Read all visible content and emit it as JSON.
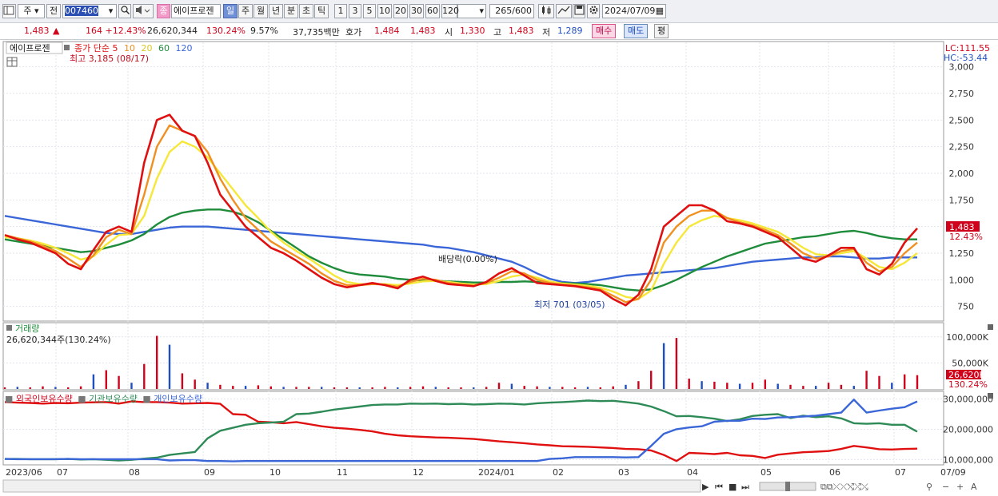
{
  "toolbar": {
    "period_type": "주",
    "prev_label": "전",
    "code": "007460",
    "indicator_label": "종",
    "stock_name": "에이프로젠",
    "timeframes": [
      "일",
      "주",
      "월",
      "년",
      "분",
      "초",
      "틱"
    ],
    "intervals": [
      "1",
      "3",
      "5",
      "10",
      "20",
      "30",
      "60",
      "120"
    ],
    "count": "265",
    "count_total": "/600",
    "date": "2024/07/09"
  },
  "quote": {
    "price": "1,483",
    "arrow": "▲",
    "change": "164 +12.43%",
    "volume": "26,620,344",
    "volume_ratio": "130.24%",
    "turnover": "9.57%",
    "amount": "37,735백만",
    "bid_label": "호가",
    "bid1": "1,484",
    "bid2": "1,483",
    "open_label": "시",
    "open": "1,330",
    "high_label": "고",
    "high": "1,483",
    "low_label": "저",
    "low": "1,289",
    "buy_label": "매수",
    "sell_label": "매도",
    "eq_label": "평"
  },
  "colors": {
    "ma5": "#e01010",
    "ma10": "#f09020",
    "ma20": "#f5e838",
    "ma60": "#1e8c3a",
    "ma120": "#3a66d8",
    "up": "#d0021b",
    "down": "#1f4fbf",
    "foreign": "#e01010",
    "institution": "#2e8b57",
    "individual": "#3a66d8"
  },
  "chart_data": [
    {
      "type": "line",
      "title": "에이프로젠",
      "legend": [
        "종가 단순 5",
        "10",
        "20",
        "60",
        "120"
      ],
      "y_ticks": [
        "3,000",
        "2,750",
        "2,500",
        "2,250",
        "2,000",
        "1,750",
        "1,500",
        "1,250",
        "1,000",
        "750"
      ],
      "ylim": [
        620,
        3230
      ],
      "x_tick_labels": [
        "2023/06",
        "07",
        "08",
        "09",
        "10",
        "11",
        "12",
        "2024/01",
        "02",
        "03",
        "04",
        "05",
        "06",
        "07",
        "07/09"
      ],
      "lc_label": "LC:111.55",
      "hc_label": "HC:-53.44",
      "last_price_label": "1,483",
      "last_change_label": "12.43%",
      "annotations": {
        "high": "최고 3,185 (08/17)",
        "low": "최저 701 (03/05)",
        "dividend": "배당락(0.00%)"
      },
      "series": [
        {
          "name": "종가 단순 5",
          "values": [
            1420,
            1380,
            1350,
            1300,
            1250,
            1150,
            1100,
            1280,
            1450,
            1500,
            1450,
            2100,
            2500,
            2550,
            2400,
            2350,
            2100,
            1800,
            1650,
            1500,
            1400,
            1300,
            1250,
            1180,
            1100,
            1020,
            960,
            930,
            950,
            970,
            950,
            920,
            1000,
            1030,
            990,
            960,
            950,
            940,
            980,
            1060,
            1110,
            1040,
            970,
            960,
            950,
            940,
            920,
            900,
            820,
            760,
            860,
            1100,
            1500,
            1600,
            1700,
            1700,
            1650,
            1550,
            1530,
            1500,
            1450,
            1400,
            1300,
            1200,
            1170,
            1230,
            1300,
            1300,
            1100,
            1050,
            1150,
            1350,
            1483
          ]
        },
        {
          "name": "10",
          "values": [
            1420,
            1390,
            1360,
            1320,
            1270,
            1200,
            1120,
            1230,
            1400,
            1470,
            1430,
            1800,
            2250,
            2450,
            2400,
            2350,
            2200,
            1950,
            1750,
            1580,
            1470,
            1360,
            1290,
            1220,
            1150,
            1060,
            990,
            950,
            950,
            960,
            955,
            935,
            980,
            1010,
            1000,
            970,
            955,
            945,
            970,
            1020,
            1080,
            1060,
            1000,
            970,
            955,
            945,
            930,
            910,
            850,
            790,
            820,
            1000,
            1350,
            1500,
            1600,
            1650,
            1650,
            1580,
            1540,
            1510,
            1470,
            1420,
            1340,
            1250,
            1200,
            1220,
            1270,
            1290,
            1160,
            1080,
            1120,
            1250,
            1350
          ]
        },
        {
          "name": "20",
          "values": [
            1400,
            1390,
            1370,
            1340,
            1300,
            1250,
            1190,
            1220,
            1330,
            1420,
            1430,
            1600,
            1950,
            2200,
            2300,
            2250,
            2150,
            2000,
            1850,
            1700,
            1580,
            1450,
            1350,
            1270,
            1200,
            1120,
            1040,
            980,
            960,
            960,
            960,
            950,
            965,
            985,
            990,
            980,
            965,
            955,
            960,
            990,
            1030,
            1050,
            1020,
            985,
            965,
            955,
            945,
            925,
            890,
            840,
            820,
            900,
            1150,
            1350,
            1500,
            1560,
            1600,
            1580,
            1560,
            1530,
            1490,
            1450,
            1380,
            1300,
            1240,
            1230,
            1250,
            1270,
            1200,
            1120,
            1100,
            1160,
            1250
          ]
        },
        {
          "name": "60",
          "values": [
            1380,
            1360,
            1340,
            1320,
            1300,
            1280,
            1260,
            1270,
            1300,
            1330,
            1370,
            1430,
            1520,
            1590,
            1630,
            1650,
            1660,
            1660,
            1640,
            1600,
            1540,
            1460,
            1380,
            1300,
            1220,
            1160,
            1110,
            1070,
            1050,
            1040,
            1030,
            1010,
            1000,
            995,
            990,
            985,
            980,
            975,
            975,
            980,
            980,
            985,
            980,
            975,
            970,
            965,
            960,
            950,
            930,
            910,
            900,
            910,
            950,
            1000,
            1060,
            1120,
            1170,
            1220,
            1260,
            1300,
            1340,
            1360,
            1380,
            1400,
            1410,
            1430,
            1450,
            1460,
            1440,
            1410,
            1390,
            1380,
            1380
          ]
        },
        {
          "name": "120",
          "values": [
            1600,
            1580,
            1560,
            1540,
            1520,
            1500,
            1480,
            1460,
            1440,
            1430,
            1430,
            1450,
            1470,
            1490,
            1500,
            1500,
            1500,
            1490,
            1480,
            1470,
            1460,
            1450,
            1440,
            1430,
            1420,
            1410,
            1400,
            1390,
            1380,
            1370,
            1360,
            1350,
            1340,
            1330,
            1310,
            1300,
            1280,
            1260,
            1230,
            1200,
            1170,
            1120,
            1060,
            1010,
            980,
            970,
            980,
            1000,
            1020,
            1040,
            1050,
            1060,
            1070,
            1080,
            1090,
            1100,
            1110,
            1130,
            1150,
            1170,
            1180,
            1190,
            1200,
            1210,
            1210,
            1220,
            1220,
            1210,
            1200,
            1200,
            1210,
            1210,
            1210
          ]
        }
      ]
    },
    {
      "type": "bar",
      "title": "거래량",
      "caption": "26,620,344주(130.24%)",
      "y_ticks": [
        "100,000K",
        "50,000K"
      ],
      "ylim": [
        0,
        115000
      ],
      "last_value_label": "26,620K",
      "last_ratio_label": "130.24%",
      "values": [
        3,
        4,
        3,
        5,
        4,
        3,
        5,
        28,
        36,
        25,
        12,
        48,
        102,
        85,
        30,
        18,
        12,
        8,
        6,
        6,
        7,
        5,
        4,
        4,
        4,
        4,
        3,
        3,
        3,
        3,
        4,
        3,
        4,
        5,
        4,
        3,
        3,
        3,
        4,
        12,
        10,
        6,
        5,
        4,
        4,
        3,
        4,
        3,
        5,
        8,
        15,
        35,
        88,
        98,
        20,
        15,
        14,
        12,
        10,
        12,
        18,
        10,
        8,
        6,
        6,
        12,
        8,
        6,
        35,
        25,
        12,
        28,
        26.6
      ]
    },
    {
      "type": "line",
      "title": "외국인보유수량",
      "legend": [
        "외국인보유수량",
        "기관보유수량",
        "개인보유수량"
      ],
      "y_ticks": [
        "30,000,000",
        "20,000,000",
        "10,000,000"
      ],
      "ylim": [
        8500000,
        32000000
      ],
      "series": [
        {
          "name": "외국인보유수량",
          "values": [
            29000000,
            28800000,
            28700000,
            28500000,
            28700000,
            28600000,
            28800000,
            28900000,
            29000000,
            28500000,
            29200000,
            29000000,
            29000000,
            28800000,
            28500000,
            28600000,
            28700000,
            28400000,
            25000000,
            24800000,
            22500000,
            22300000,
            22000000,
            22400000,
            21700000,
            21000000,
            20500000,
            20200000,
            19800000,
            19300000,
            18500000,
            18000000,
            17700000,
            17500000,
            17300000,
            17200000,
            17000000,
            16800000,
            16400000,
            16000000,
            15700000,
            15400000,
            15000000,
            14700000,
            14400000,
            14300000,
            14200000,
            14000000,
            13800000,
            13500000,
            13400000,
            13000000,
            11500000,
            9500000,
            12200000,
            12000000,
            11800000,
            12200000,
            11400000,
            11200000,
            10500000,
            11600000,
            12000000,
            12400000,
            12600000,
            12800000,
            13500000,
            14500000,
            14000000,
            13400000,
            13300000,
            13500000,
            13600000
          ]
        },
        {
          "name": "기관보유수량",
          "values": [
            10200000,
            10200000,
            10100000,
            10100000,
            10100000,
            10200000,
            10000000,
            10100000,
            9900000,
            9700000,
            9900000,
            10300000,
            10600000,
            11500000,
            12000000,
            12500000,
            17000000,
            19500000,
            20500000,
            21500000,
            22000000,
            22200000,
            22500000,
            25000000,
            25200000,
            25800000,
            26500000,
            27000000,
            27500000,
            28000000,
            28200000,
            28200000,
            28500000,
            28400000,
            28500000,
            28300000,
            28400000,
            28200000,
            28300000,
            28500000,
            28400000,
            28200000,
            28600000,
            28800000,
            29000000,
            29200000,
            29500000,
            29300000,
            29400000,
            29000000,
            28500000,
            27500000,
            26000000,
            24300000,
            24400000,
            24000000,
            23500000,
            22700000,
            23300000,
            24400000,
            24800000,
            25000000,
            23700000,
            24500000,
            24000000,
            24300000,
            23600000,
            22000000,
            21800000,
            22000000,
            21500000,
            21500000,
            19200000
          ]
        },
        {
          "name": "개인보유수량",
          "values": [
            10200000,
            10100000,
            10100000,
            10100000,
            10100000,
            10200000,
            10100000,
            10100000,
            10100000,
            10100000,
            10100000,
            10100000,
            10100000,
            9700000,
            9800000,
            9800000,
            9500000,
            9500000,
            9400000,
            9500000,
            9500000,
            9500000,
            9500000,
            9500000,
            9500000,
            9500000,
            9500000,
            9500000,
            9500000,
            9500000,
            9500000,
            9500000,
            9500000,
            9500000,
            9500000,
            9500000,
            9500000,
            9500000,
            9500000,
            9500000,
            9500000,
            9500000,
            9500000,
            10200000,
            10400000,
            10800000,
            10800000,
            10800000,
            10800000,
            10700000,
            10800000,
            14500000,
            18500000,
            20000000,
            20600000,
            21000000,
            22500000,
            22800000,
            22800000,
            23500000,
            23400000,
            23900000,
            24000000,
            24200000,
            24500000,
            25000000,
            25500000,
            29800000,
            25500000,
            26200000,
            26800000,
            27300000,
            29200000
          ]
        }
      ]
    }
  ],
  "x_axis_labels": [
    "2023/06",
    "07",
    "08",
    "09",
    "10",
    "11",
    "12",
    "2024/01",
    "02",
    "03",
    "04",
    "05",
    "06",
    "07",
    "07/09"
  ]
}
